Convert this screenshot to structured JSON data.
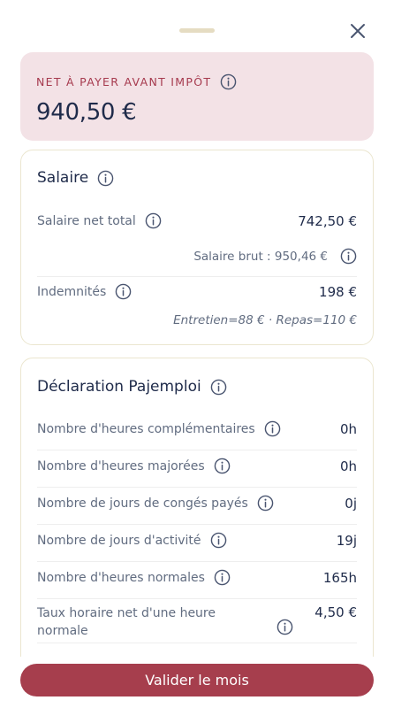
{
  "net": {
    "label": "NET À PAYER AVANT IMPÔT",
    "value": "940,50 €"
  },
  "salaire": {
    "title": "Salaire",
    "net_total_label": "Salaire net total",
    "net_total_value": "742,50 €",
    "brut_text": "Salaire brut : 950,46 €",
    "indemnites_label": "Indemnités",
    "indemnites_value": "198 €",
    "indemnites_detail": "Entretien=88 € · Repas=110 €"
  },
  "pajemploi": {
    "title": "Déclaration Pajemploi",
    "rows": [
      {
        "label": "Nombre d'heures complémentaires",
        "value": "0h"
      },
      {
        "label": "Nombre d'heures majorées",
        "value": "0h"
      },
      {
        "label": "Nombre de jours de congés payés",
        "value": "0j"
      },
      {
        "label": "Nombre de jours d'activité",
        "value": "19j"
      },
      {
        "label": "Nombre d'heures normales",
        "value": "165h"
      },
      {
        "label": "Taux horaire net d'une heure normale",
        "value": "4,50 €"
      }
    ]
  },
  "cta": {
    "label": "Valider le mois"
  },
  "colors": {
    "accent": "#a63e4d",
    "net_bg": "#f3e2e6",
    "text": "#1f2b4a",
    "muted": "#616c80"
  }
}
